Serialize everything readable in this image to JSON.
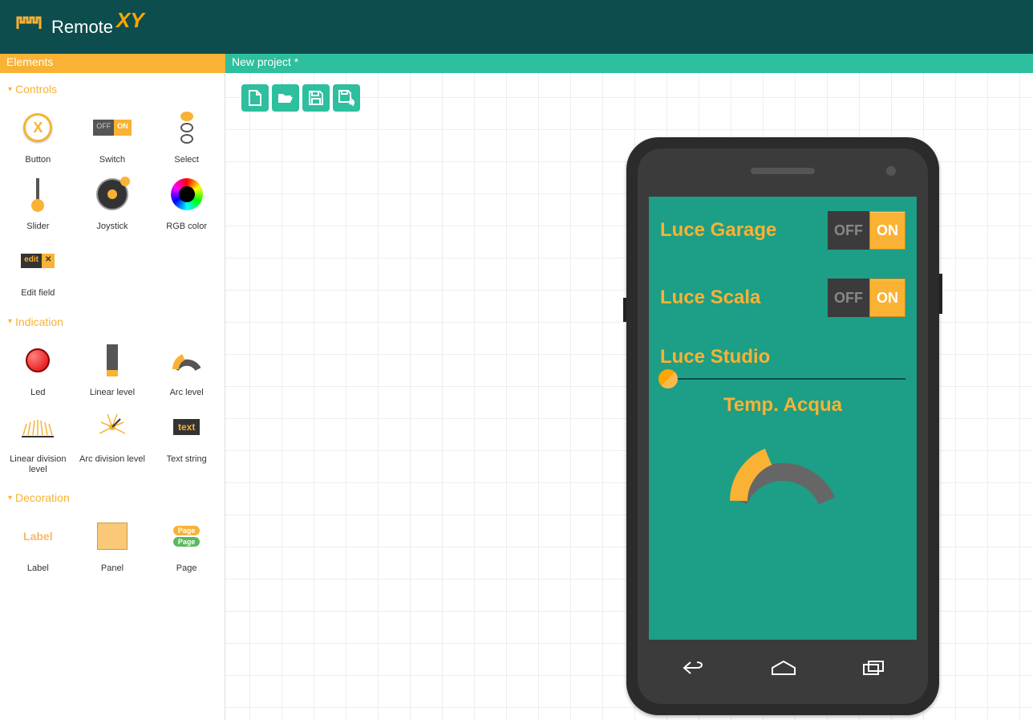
{
  "app": {
    "brand_prefix": "Remote",
    "brand_suffix": "XY"
  },
  "subheader": {
    "left": "Elements",
    "right": "New project *"
  },
  "sections": {
    "controls": "Controls",
    "indication": "Indication",
    "decoration": "Decoration"
  },
  "palette": {
    "controls": [
      {
        "id": "button",
        "label": "Button"
      },
      {
        "id": "switch",
        "label": "Switch"
      },
      {
        "id": "select",
        "label": "Select"
      },
      {
        "id": "slider",
        "label": "Slider"
      },
      {
        "id": "joystick",
        "label": "Joystick"
      },
      {
        "id": "rgb",
        "label": "RGB color"
      },
      {
        "id": "editfield",
        "label": "Edit field"
      }
    ],
    "indication": [
      {
        "id": "led",
        "label": "Led"
      },
      {
        "id": "linlevel",
        "label": "Linear level"
      },
      {
        "id": "arclevel",
        "label": "Arc level"
      },
      {
        "id": "lindiv",
        "label": "Linear division level"
      },
      {
        "id": "arcdiv",
        "label": "Arc division level"
      },
      {
        "id": "text",
        "label": "Text string"
      }
    ],
    "decoration": [
      {
        "id": "label",
        "label": "Label"
      },
      {
        "id": "panel",
        "label": "Panel"
      },
      {
        "id": "page",
        "label": "Page"
      }
    ]
  },
  "palette_text": {
    "switch_off": "OFF",
    "switch_on": "ON",
    "edit_text": "edit",
    "edit_x": "✕",
    "text_string": "text",
    "label_text": "Label",
    "page_text": "Page",
    "button_x": "X"
  },
  "toolbar": {
    "new": "new-file",
    "open": "open-file",
    "save": "save-file",
    "saveas": "save-as-file"
  },
  "screen": {
    "row1": {
      "label": "Luce Garage",
      "off": "OFF",
      "on": "ON",
      "state": "on"
    },
    "row2": {
      "label": "Luce Scala",
      "off": "OFF",
      "on": "ON",
      "state": "on"
    },
    "row3": {
      "label": "Luce Studio",
      "slider_value": 0
    },
    "row4": {
      "label": "Temp. Acqua",
      "arc_percent": 45
    }
  },
  "colors": {
    "accent": "#f9b233",
    "teal": "#2dbf9e",
    "dark_teal": "#0d4d4d",
    "screen_bg": "#1d9e86",
    "phone_body": "#3b3b3b"
  }
}
